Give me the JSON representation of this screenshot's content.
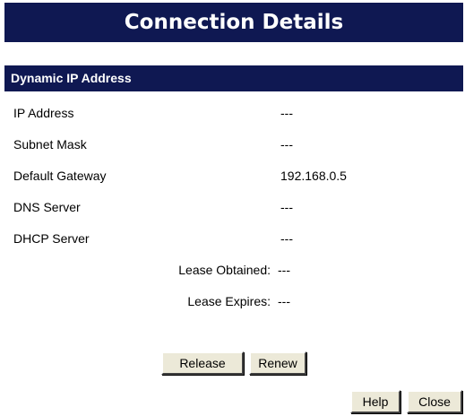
{
  "title": "Connection Details",
  "section": {
    "title": "Dynamic IP Address"
  },
  "fields": [
    {
      "label": "IP Address",
      "value": "---"
    },
    {
      "label": "Subnet Mask",
      "value": "---"
    },
    {
      "label": "Default Gateway",
      "value": "192.168.0.5"
    },
    {
      "label": "DNS Server",
      "value": "---"
    },
    {
      "label": "DHCP Server",
      "value": "---"
    }
  ],
  "lease": [
    {
      "label": "Lease Obtained:",
      "value": "---"
    },
    {
      "label": "Lease Expires:",
      "value": "---"
    }
  ],
  "buttons": {
    "release": "Release",
    "renew": "Renew",
    "help": "Help",
    "close": "Close"
  },
  "colors": {
    "header_background": "#0f1852",
    "header_text": "#ffffff",
    "button_face": "#ece9d8"
  }
}
